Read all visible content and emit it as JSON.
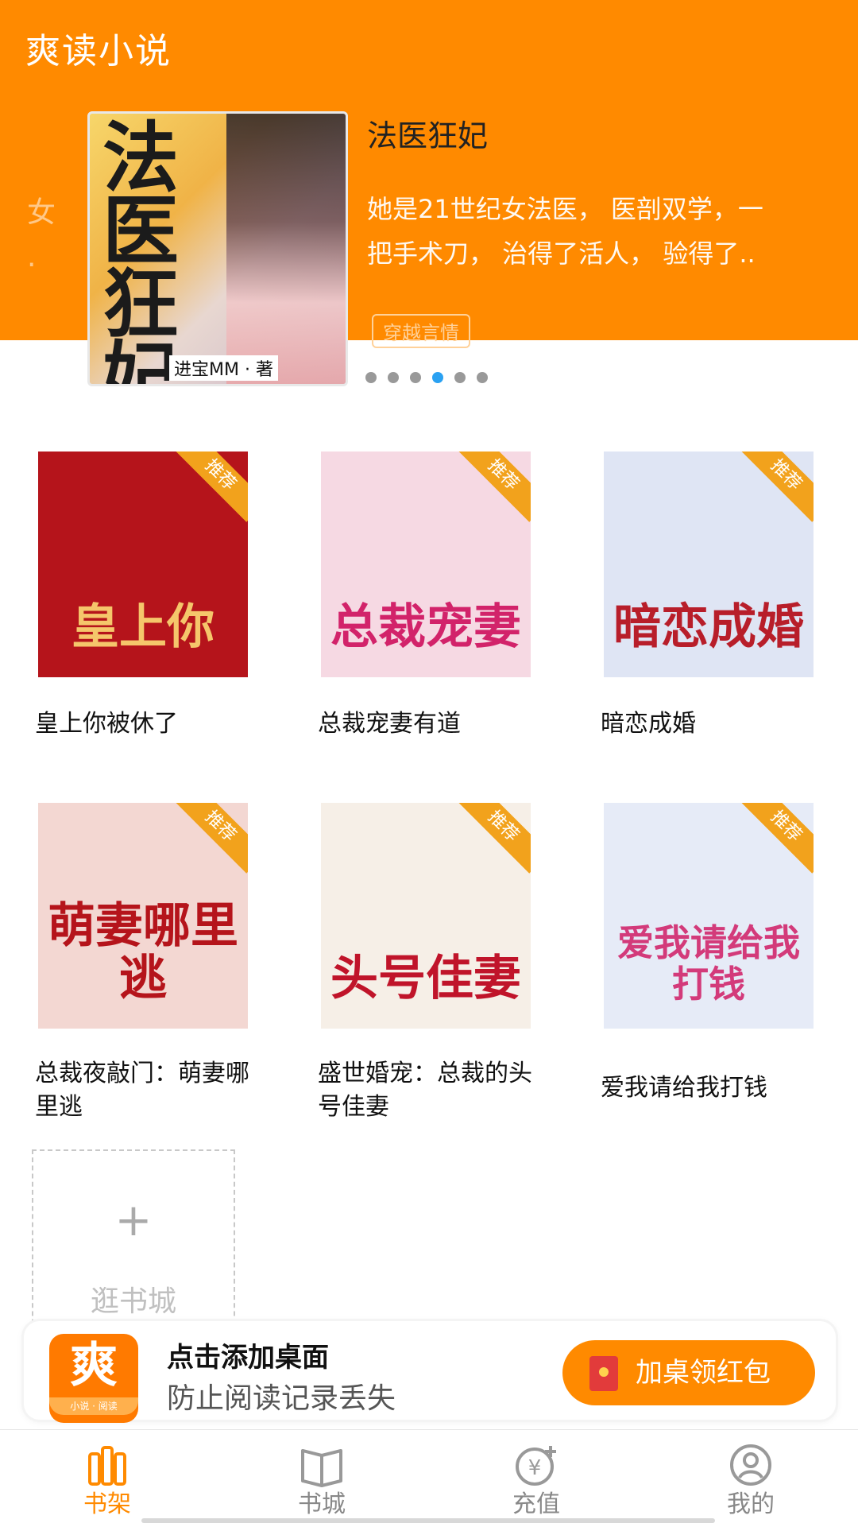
{
  "app": {
    "title": "爽读小说"
  },
  "carousel": {
    "feature": {
      "title": "法医狂妃",
      "description_line1": "她是21世纪女法医， 医剖双学，一",
      "description_line2": "把手术刀， 治得了活人， 验得了..",
      "tag": "穿越言情",
      "cover_title": "法医狂妃",
      "cover_author": "进宝MM · 著"
    },
    "prev_peek": "女\n.",
    "dots_count": 6,
    "active_dot_index": 3
  },
  "shelf": {
    "ribbon_label": "推荐",
    "books": [
      {
        "title": "皇上你被休了",
        "cover_text": "皇上你",
        "cover_bg": "#b5141b",
        "cover_fg": "#f5c66b"
      },
      {
        "title": "总裁宠妻有道",
        "cover_text": "总裁宠妻",
        "cover_bg": "#f6d9e3",
        "cover_fg": "#d2236a"
      },
      {
        "title": "暗恋成婚",
        "cover_text": "暗恋成婚",
        "cover_bg": "#dfe5f4",
        "cover_fg": "#b81e2a"
      },
      {
        "title": "总裁夜敲门：萌妻哪里逃",
        "cover_text": "萌妻哪里逃",
        "cover_bg": "#f3d7d2",
        "cover_fg": "#b5141b"
      },
      {
        "title": "盛世婚宠：总裁的头号佳妻",
        "cover_text": "头号佳妻",
        "cover_bg": "#f6efe7",
        "cover_fg": "#c0142a"
      },
      {
        "title": "爱我请给我打钱",
        "cover_text": "爱我请给我打钱",
        "cover_bg": "#e6ebf7",
        "cover_fg": "#d33a7a"
      }
    ],
    "add_label": "逛书城",
    "add_symbol": "+"
  },
  "banner": {
    "logo_glyph": "爽",
    "logo_caption": "小说 · 阅读",
    "title": "点击添加桌面",
    "subtitle": "防止阅读记录丢失",
    "button_label": "加桌领红包"
  },
  "tabbar": {
    "items": [
      {
        "label": "书架",
        "icon": "bookshelf-icon",
        "active": true
      },
      {
        "label": "书城",
        "icon": "open-book-icon",
        "active": false
      },
      {
        "label": "充值",
        "icon": "yen-coin-icon",
        "active": false
      },
      {
        "label": "我的",
        "icon": "user-icon",
        "active": false
      }
    ]
  },
  "colors": {
    "accent": "#ff8a00",
    "ribbon": "#f2a21c",
    "dot_active": "#2aa1f2",
    "dot_inactive": "#999999"
  }
}
